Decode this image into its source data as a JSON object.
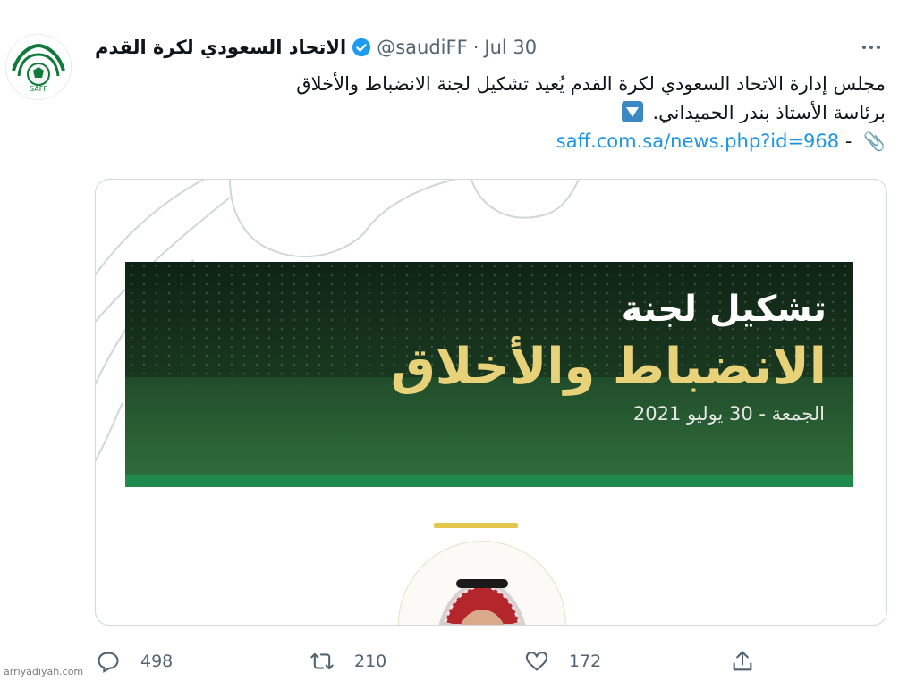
{
  "tweet": {
    "display_name": "الاتحاد السعودي لكرة القدم",
    "handle": "@saudiFF",
    "separator": "·",
    "date": "Jul 30",
    "text_line1": "مجلس إدارة الاتحاد السعودي لكرة القدم يُعيد تشكيل لجنة الانضباط والأخلاق",
    "text_line2": "برئاسة الأستاذ بندر الحميداني.",
    "link_prefix": "-",
    "link": "saff.com.sa/news.php?id=968"
  },
  "avatar": {
    "logo_text": "SAFF"
  },
  "card": {
    "line1": "تشكيل لجنة",
    "line2": "الانضباط والأخلاق",
    "line3": "الجمعة - 30 يوليو 2021"
  },
  "actions": {
    "reply_count": "498",
    "retweet_count": "210",
    "like_count": "172"
  },
  "watermark": "arriyadiyah.com",
  "icons": [
    "verified-badge-icon",
    "more-icon",
    "down-arrow-emoji-icon",
    "paperclip-icon",
    "reply-icon",
    "retweet-icon",
    "like-icon",
    "share-icon"
  ],
  "colors": {
    "link": "#1b95e0",
    "verified": "#1d9bf0",
    "muted": "#536471",
    "gold": "#e7d27a"
  }
}
